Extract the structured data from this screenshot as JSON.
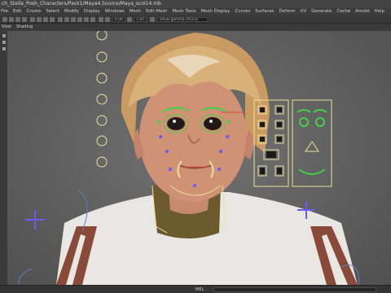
{
  "window": {
    "title": "ch_Stella_Posh_Characters/Pack1/Maya4.Source/Maya_scol14.mb"
  },
  "menubar": {
    "items": [
      "File",
      "Edit",
      "Create",
      "Select",
      "Modify",
      "Display",
      "Windows",
      "Mesh",
      "Edit Mesh",
      "Mesh Tools",
      "Mesh Display",
      "Curves",
      "Surfaces",
      "Deform",
      "UV",
      "Generate",
      "Cache",
      "Arnold",
      "Help"
    ]
  },
  "toolbar": {
    "field_left": "0.00",
    "field_right": "1.00",
    "camera_field": "sRGB gamma (ACES)"
  },
  "panel_menu": {
    "items": [
      "View",
      "Shading"
    ]
  },
  "statusbar": {
    "label": "MEL"
  },
  "colors": {
    "control_green": "#46d04a",
    "control_yellow": "#e9e29a",
    "control_purple": "#6a5cf0",
    "control_red": "#e24a3c",
    "ui_dark": "#3c3c3c"
  },
  "icons": {
    "face_panel": "face-control-panel-icon",
    "sidebar": "tool-icon"
  }
}
